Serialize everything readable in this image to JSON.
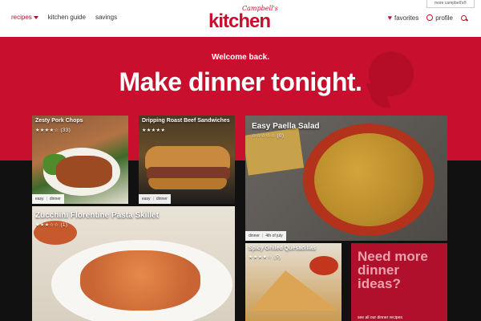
{
  "header": {
    "nav_left": [
      "recipes",
      "kitchen guide",
      "savings"
    ],
    "logo_brand": "Campbell's",
    "logo_word": "kitchen",
    "more_campbells": "more campbell's®",
    "favorites": "favorites",
    "profile": "profile"
  },
  "hero": {
    "welcome": "Welcome back.",
    "headline": "Make dinner tonight."
  },
  "cards": [
    {
      "title": "Zesty Pork Chops",
      "stars": "★★★★☆ (33)",
      "tags": [
        "easy",
        "dinner"
      ]
    },
    {
      "title": "Dripping Roast Beef Sandwiches",
      "stars": "★★★★★",
      "tags": [
        "easy",
        "dinner"
      ]
    },
    {
      "title": "Easy Paella Salad",
      "stars": "☆☆☆☆☆ (0)",
      "tags": [
        "dinner",
        "4th of july"
      ]
    },
    {
      "title": "Zucchini Florentine Pasta Skillet",
      "stars": "★★★☆☆ (1)",
      "tags": []
    },
    {
      "title": "Spicy Grilled Quesadillas",
      "stars": "★★★★☆ (5)",
      "tags": []
    }
  ],
  "promo": {
    "text": "Need more dinner ideas?",
    "link": "see all our dinner recipes"
  },
  "colors": {
    "brand": "#c8102e",
    "promo_bg": "#b0102b",
    "promo_text": "#e9a1ac"
  }
}
